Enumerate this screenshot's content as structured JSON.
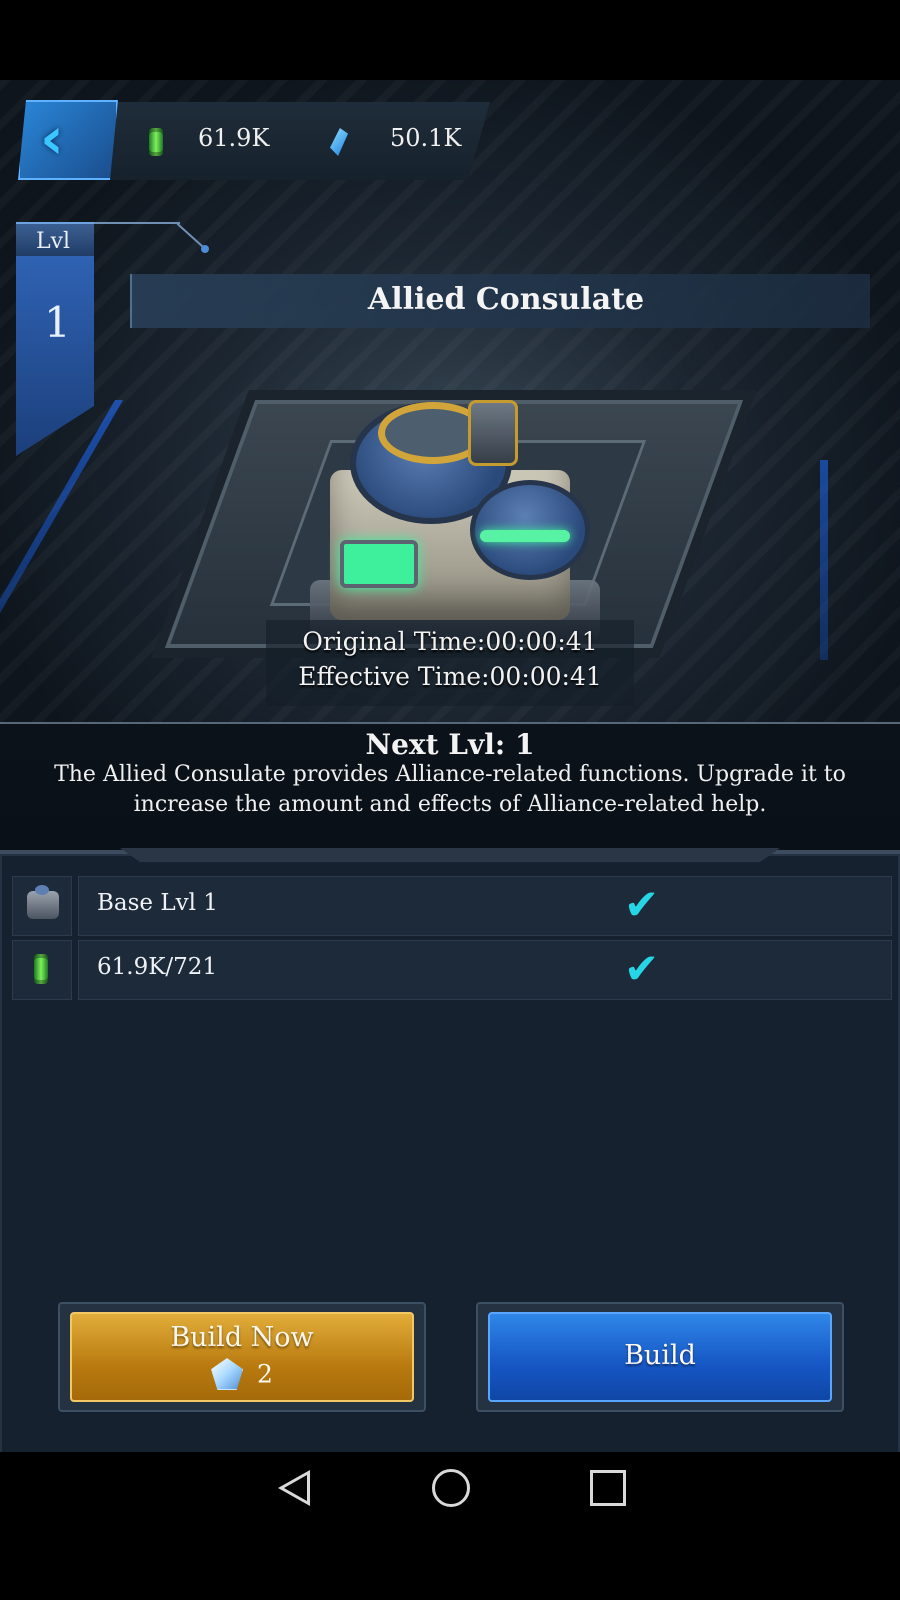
{
  "resources": {
    "oil": {
      "icon": "oil-barrel-icon",
      "value": "61.9K"
    },
    "crystal": {
      "icon": "crystal-icon",
      "value": "50.1K"
    }
  },
  "building": {
    "level_label": "Lvl",
    "level": "1",
    "name": "Allied Consulate",
    "original_time": "Original Time:00:00:41",
    "effective_time": "Effective Time:00:00:41"
  },
  "details": {
    "next_level": "Next Lvl: 1",
    "description": "The Allied Consulate provides Alliance-related functions. Upgrade it to increase the amount and effects of Alliance-related help."
  },
  "requirements": [
    {
      "icon": "base-building-icon",
      "label": "Base Lvl 1",
      "met": true
    },
    {
      "icon": "oil-barrel-icon",
      "label": "61.9K/721",
      "met": true
    }
  ],
  "buttons": {
    "build_now": {
      "label": "Build Now",
      "gem_cost": "2"
    },
    "build": {
      "label": "Build"
    }
  },
  "colors": {
    "build_now": "#c98d1e",
    "build": "#1b62d0",
    "check": "#27d6e6",
    "panel": "#16212f"
  }
}
